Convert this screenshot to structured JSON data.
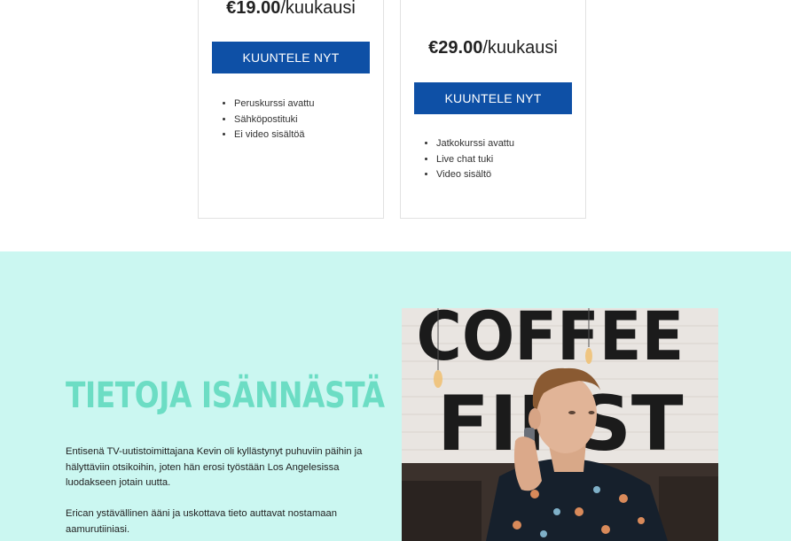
{
  "plans": [
    {
      "amount": "€19.00",
      "period": "/kuukausi",
      "button": "KUUNTELE NYT",
      "features": [
        "Peruskurssi avattu",
        "Sähköpostituki",
        "Ei video sisältöä"
      ]
    },
    {
      "amount": "€29.00",
      "period": "/kuukausi",
      "button": "KUUNTELE NYT",
      "features": [
        "Jatkokurssi avattu",
        "Live chat tuki",
        "Video sisältö"
      ]
    }
  ],
  "about": {
    "title": "TIETOJA ISÄNNÄSTÄ",
    "paragraphs": [
      "Entisenä TV-uutistoimittajana Kevin oli kyllästynyt puhuviin päihin ja hälyttäviin otsikoihin, joten hän erosi työstään Los Angelesissa luodakseen jotain uutta.",
      "Erican ystävällinen ääni ja uskottava tieto auttavat nostamaan aamurutiiniasi."
    ]
  },
  "photo": {
    "wall_sign": [
      "COFFEE",
      "FIRST"
    ]
  },
  "colors": {
    "button": "#0e50a6",
    "about_background": "#cbf7f1",
    "about_title": "#6cddc4"
  }
}
